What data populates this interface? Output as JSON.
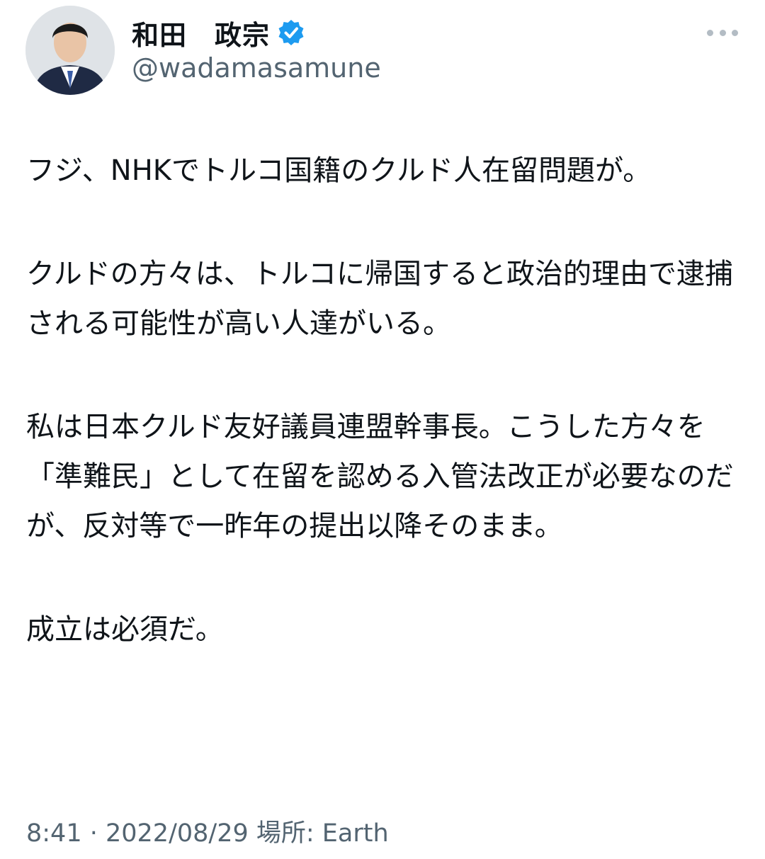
{
  "user": {
    "display_name": "和田　政宗",
    "handle": "@wadamasamune",
    "avatar_icon": "user-avatar",
    "verified_icon": "verified-badge-icon",
    "verified_color": "#1d9bf0"
  },
  "tweet": {
    "paragraphs": [
      "フジ、NHKでトルコ国籍のクルド人在留問題が。",
      "クルドの方々は、トルコに帰国すると政治的理由で逮捕される可能性が高い人達がいる。",
      "私は日本クルド友好議員連盟幹事長。こうした方々を「準難民」として在留を認める入管法改正が必要なのだが、反対等で一昨年の提出以降そのまま。",
      "成立は必須だ。"
    ]
  },
  "meta": {
    "time": "8:41",
    "separator": " · ",
    "date": "2022/08/29",
    "location_label": "場所: ",
    "location": "Earth"
  },
  "more_icon": "more-dots-icon"
}
